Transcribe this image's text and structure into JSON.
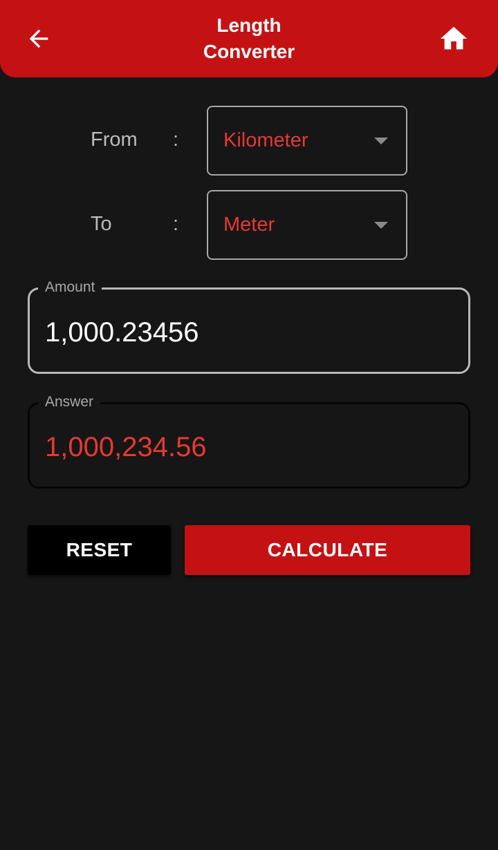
{
  "header": {
    "title_line1": "Length",
    "title_line2": "Converter",
    "back_icon": "arrow-left-icon",
    "home_icon": "home-icon",
    "background_color": "#c41214"
  },
  "from_row": {
    "label": "From",
    "colon": ":",
    "selected_value": "Kilometer"
  },
  "to_row": {
    "label": "To",
    "colon": ":",
    "selected_value": "Meter"
  },
  "amount_field": {
    "label": "Amount",
    "value": "1,000.23456"
  },
  "answer_field": {
    "label": "Answer",
    "value": "1,000,234.56",
    "value_color": "#e53a30"
  },
  "buttons": {
    "reset_label": "RESET",
    "calculate_label": "CALCULATE"
  },
  "colors": {
    "accent": "#c41214",
    "background": "#161616",
    "highlight_text": "#e53a30"
  }
}
